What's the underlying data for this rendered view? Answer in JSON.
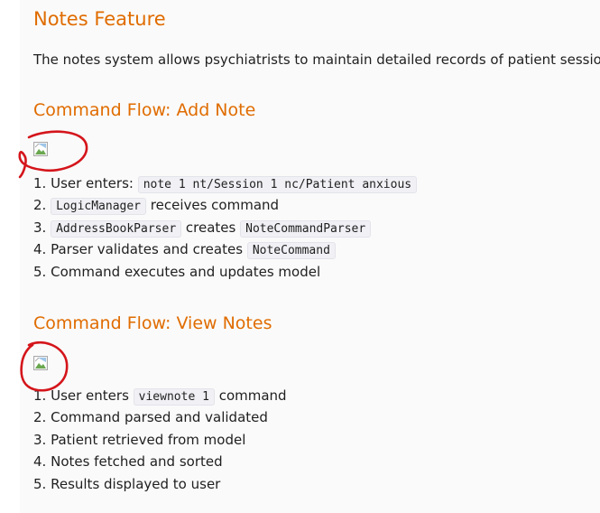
{
  "doc": {
    "title": "Notes Feature",
    "intro": "The notes system allows psychiatrists to maintain detailed records of patient sessions.",
    "sections": [
      {
        "heading": "Command Flow: Add Note",
        "steps": [
          {
            "num": "1.",
            "before": "User enters: ",
            "code": "note 1 nt/Session 1 nc/Patient anxious"
          },
          {
            "num": "2.",
            "code": "LogicManager",
            "after": " receives command"
          },
          {
            "num": "3.",
            "code": "AddressBookParser",
            "middle": " creates ",
            "code2": "NoteCommandParser"
          },
          {
            "num": "4.",
            "before": "Parser validates and creates ",
            "code": "NoteCommand"
          },
          {
            "num": "5.",
            "before": "Command executes and updates model"
          }
        ]
      },
      {
        "heading": "Command Flow: View Notes",
        "steps": [
          {
            "num": "1.",
            "before": "User enters ",
            "code": "viewnote 1",
            "after": " command"
          },
          {
            "num": "2.",
            "before": "Command parsed and validated"
          },
          {
            "num": "3.",
            "before": "Patient retrieved from model"
          },
          {
            "num": "4.",
            "before": "Notes fetched and sorted"
          },
          {
            "num": "5.",
            "before": "Results displayed to user"
          }
        ]
      }
    ]
  },
  "colors": {
    "heading": "#e06c00",
    "annotation_circle": "#d4151b"
  },
  "icons": {
    "broken_image": "broken-image-icon"
  }
}
